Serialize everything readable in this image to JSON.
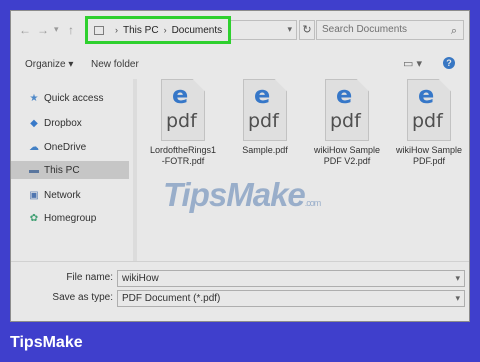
{
  "address": {
    "root": "This PC",
    "folder": "Documents",
    "search_placeholder": "Search Documents"
  },
  "toolbar": {
    "organize": "Organize",
    "new_folder": "New folder"
  },
  "sidebar": {
    "items": [
      {
        "label": "Quick access",
        "icon": "star-icon"
      },
      {
        "label": "Dropbox",
        "icon": "dropbox-icon"
      },
      {
        "label": "OneDrive",
        "icon": "cloud-icon"
      },
      {
        "label": "This PC",
        "icon": "computer-icon",
        "selected": true
      },
      {
        "label": "Network",
        "icon": "network-icon"
      },
      {
        "label": "Homegroup",
        "icon": "homegroup-icon"
      }
    ]
  },
  "files": [
    {
      "line1": "LordoftheRings1",
      "line2": "-FOTR.pdf",
      "icon_letter": "e",
      "icon_text": "pdf"
    },
    {
      "line1": "Sample.pdf",
      "line2": "",
      "icon_letter": "e",
      "icon_text": "pdf"
    },
    {
      "line1": "wikiHow Sample",
      "line2": "PDF V2.pdf",
      "icon_letter": "e",
      "icon_text": "pdf"
    },
    {
      "line1": "wikiHow Sample",
      "line2": "PDF.pdf",
      "icon_letter": "e",
      "icon_text": "pdf"
    }
  ],
  "form": {
    "file_name_label": "File name:",
    "file_name_value": "wikiHow",
    "type_label": "Save as type:",
    "type_value": "PDF Document (*.pdf)"
  },
  "watermark": {
    "text": "TipsMake",
    "suffix": ".com"
  },
  "brand": "TipsMake",
  "colors": {
    "background": "#3f3fcc",
    "highlight": "#11e011",
    "edge_blue": "#1b6fd6"
  }
}
